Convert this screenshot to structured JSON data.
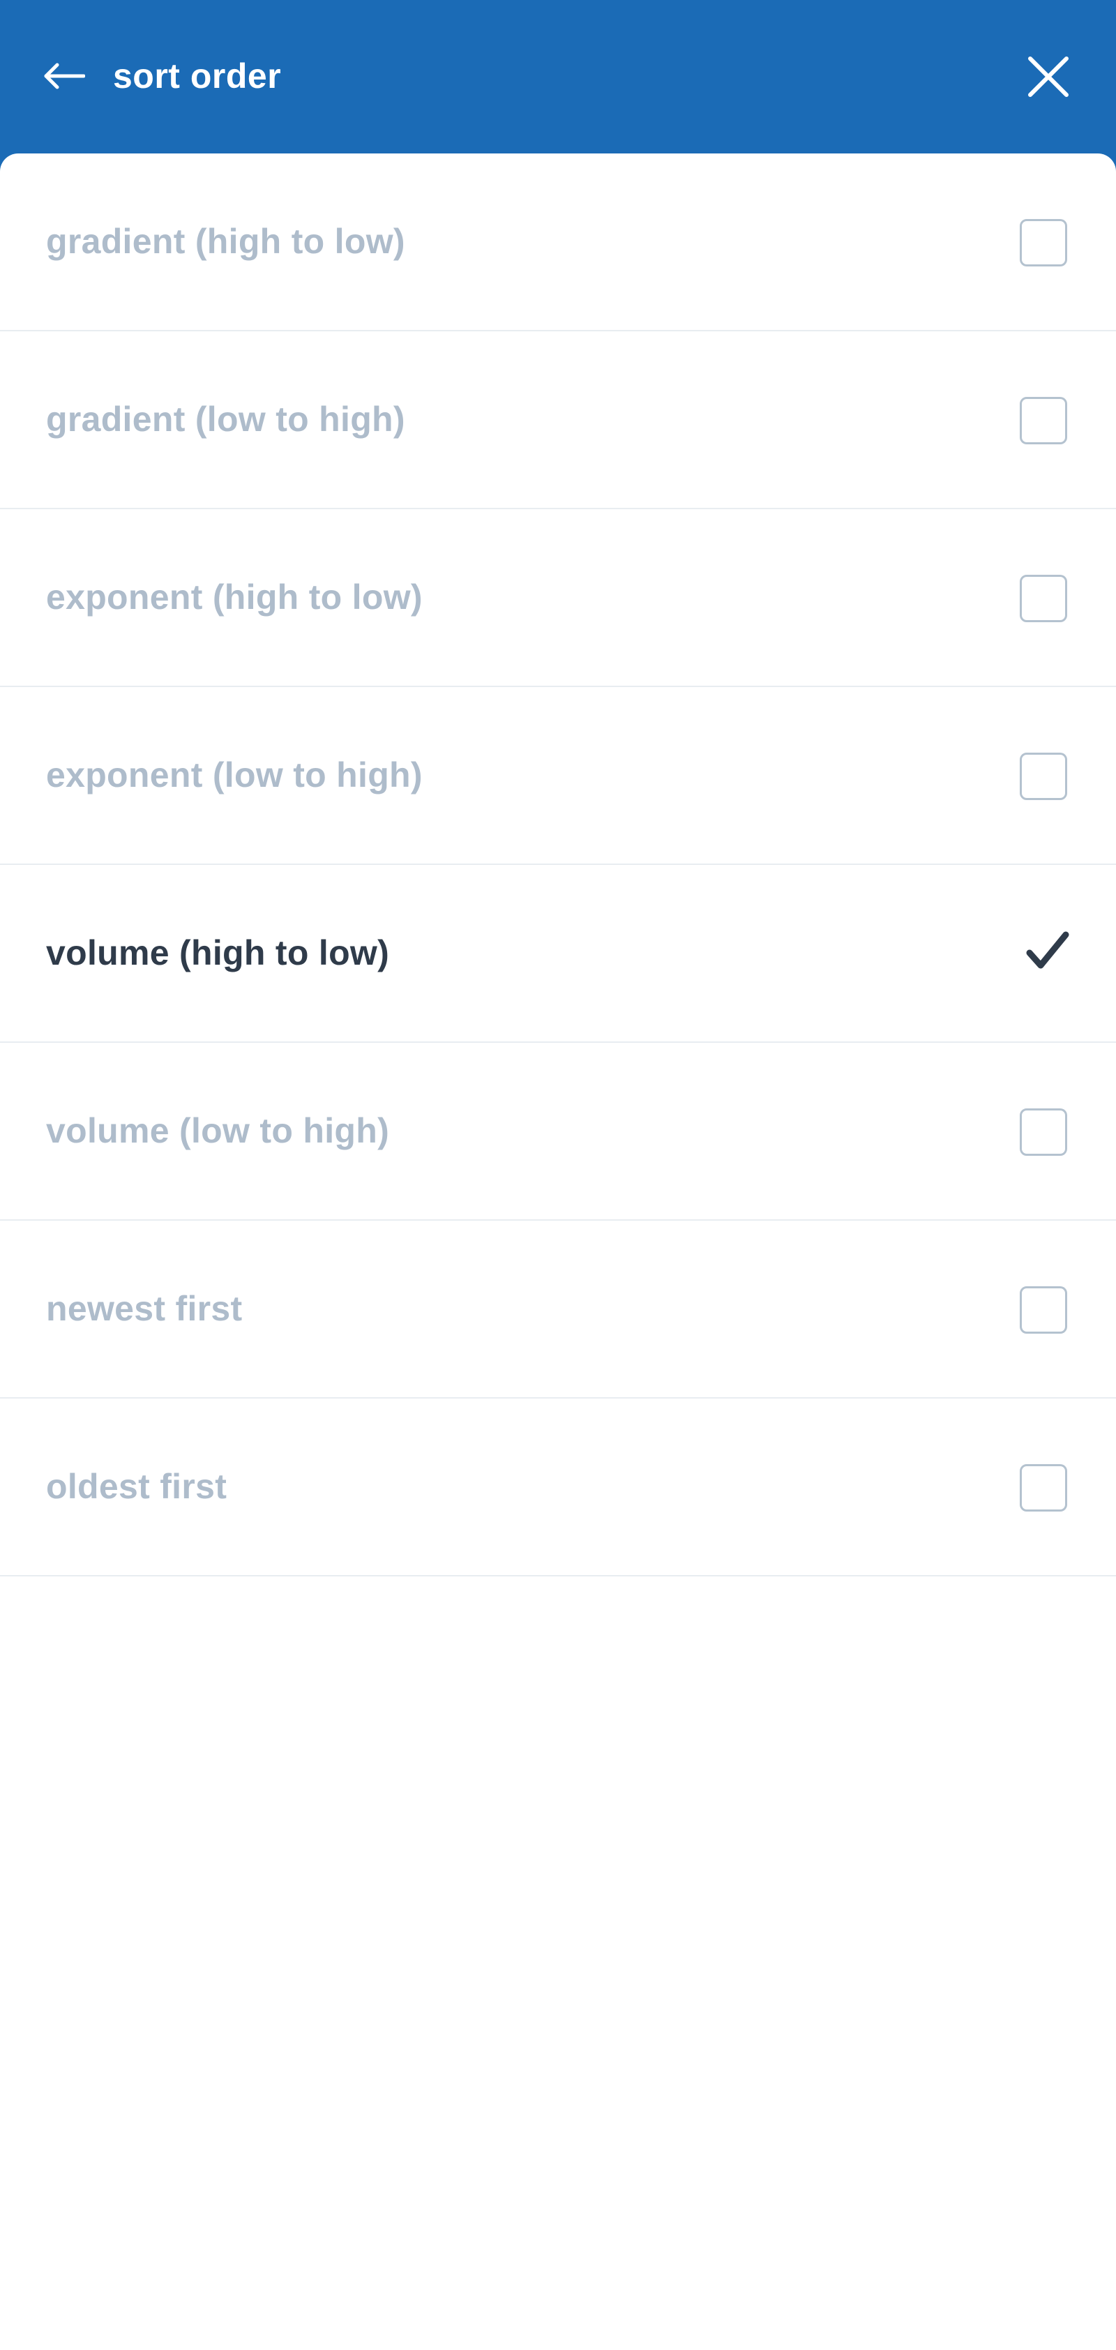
{
  "header": {
    "title": "sort order",
    "back_icon": "arrow-left-icon",
    "close_icon": "close-icon",
    "background_color": "#1b6bb6"
  },
  "options": [
    {
      "label": "gradient (high to low)",
      "selected": false
    },
    {
      "label": "gradient (low to high)",
      "selected": false
    },
    {
      "label": "exponent (high to low)",
      "selected": false
    },
    {
      "label": "exponent (low to high)",
      "selected": false
    },
    {
      "label": "volume (high to low)",
      "selected": true
    },
    {
      "label": "volume (low to high)",
      "selected": false
    },
    {
      "label": "newest first",
      "selected": false
    },
    {
      "label": "oldest first",
      "selected": false
    }
  ],
  "colors": {
    "selected_text": "#2f3b4a",
    "unselected_text": "#aebccb",
    "checkbox_border": "#b4c2cf",
    "divider": "#e8edf1"
  }
}
